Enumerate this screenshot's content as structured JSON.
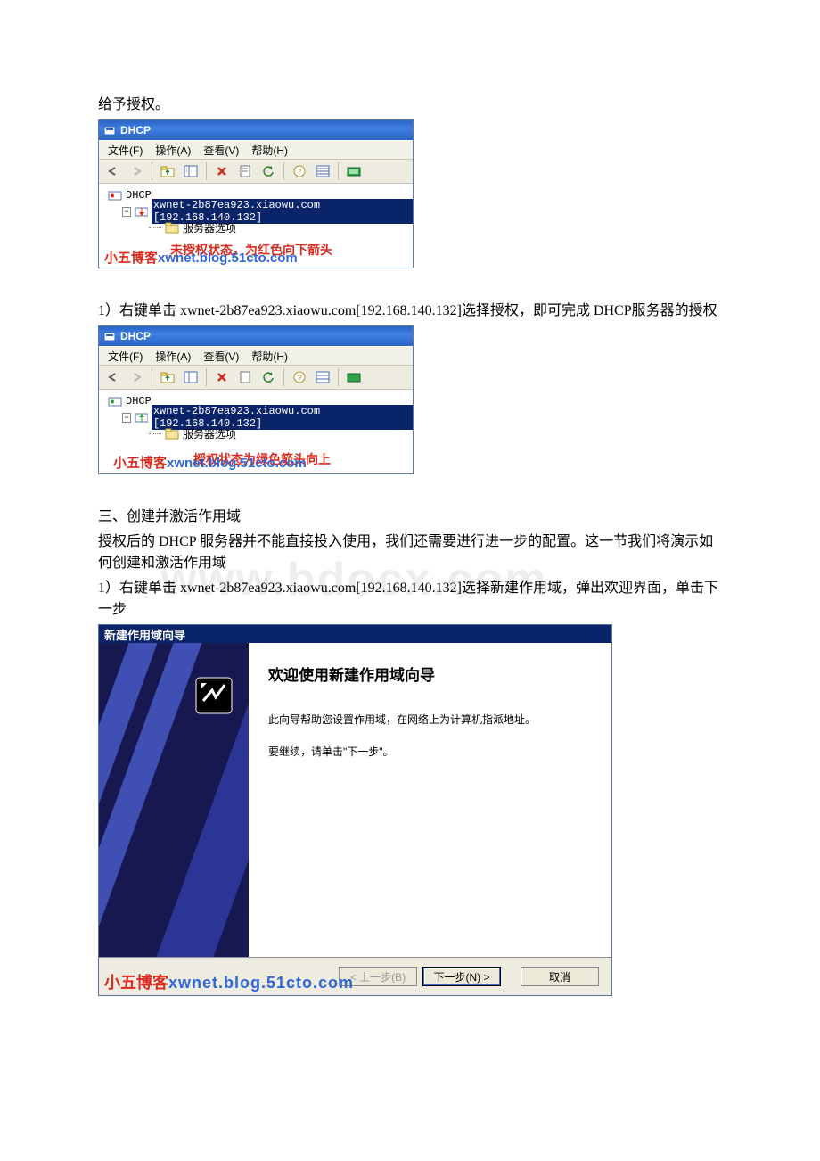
{
  "text": {
    "p0": "给予授权。",
    "p1": "1）右键单击 xwnet-2b87ea923.xiaowu.com[192.168.140.132]选择授权，即可完成 DHCP服务器的授权",
    "p2": "三、创建并激活作用域",
    "p3": "授权后的 DHCP 服务器并不能直接投入使用，我们还需要进行进一步的配置。这一节我们将演示如何创建和激活作用域",
    "p4": "1）右键单击 xwnet-2b87ea923.xiaowu.com[192.168.140.132]选择新建作用域，弹出欢迎界面，单击下一步"
  },
  "watermark": "www.bdocx.com",
  "mmc": {
    "title": "DHCP",
    "menu": {
      "file": "文件(F)",
      "action": "操作(A)",
      "view": "查看(V)",
      "help": "帮助(H)"
    },
    "tree": {
      "root": "DHCP",
      "server": "xwnet-2b87ea923.xiaowu.com [192.168.140.132]",
      "server_options": "服务器选项"
    },
    "footer1_red": "未授权状态，为红色向下箭头",
    "footer2_red": "授权状态为绿色箭头向上",
    "blog_label": "小五博客",
    "blog_url": "xwnet.blog.51cto.com"
  },
  "wizard": {
    "title": "新建作用域向导",
    "heading": "欢迎使用新建作用域向导",
    "desc": "此向导帮助您设置作用域，在网络上为计算机指派地址。",
    "cont": "要继续，请单击\"下一步\"。",
    "btn_back": "< 上一步(B)",
    "btn_next": "下一步(N) >",
    "btn_cancel": "取消"
  }
}
